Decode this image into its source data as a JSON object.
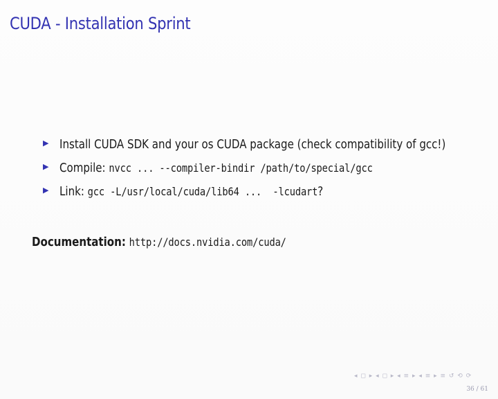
{
  "slide": {
    "title": "CUDA - Installation Sprint",
    "bullets": [
      {
        "text": "Install CUDA SDK and your os CUDA package (check compatibility of gcc!)"
      },
      {
        "prefix": "Compile: ",
        "code": "nvcc ... --compiler-bindir /path/to/special/gcc"
      },
      {
        "prefix": "Link: ",
        "code": "gcc -L/usr/local/cuda/lib64 ...  -lcudart",
        "suffix": "?"
      }
    ],
    "documentation": {
      "label": "Documentation:",
      "url": "http://docs.nvidia.com/cuda/"
    },
    "nav_symbols": "◂ ◻ ▸ ◂ ◻ ▸ ◂ ≡ ▸ ◂ ≡ ▸  ≡  ↺ ⟲ ⟳",
    "page_number": "36 / 61"
  },
  "colors": {
    "title": "#3333b2",
    "bullet_marker": "#3333b2",
    "text": "#1a1a1a"
  }
}
